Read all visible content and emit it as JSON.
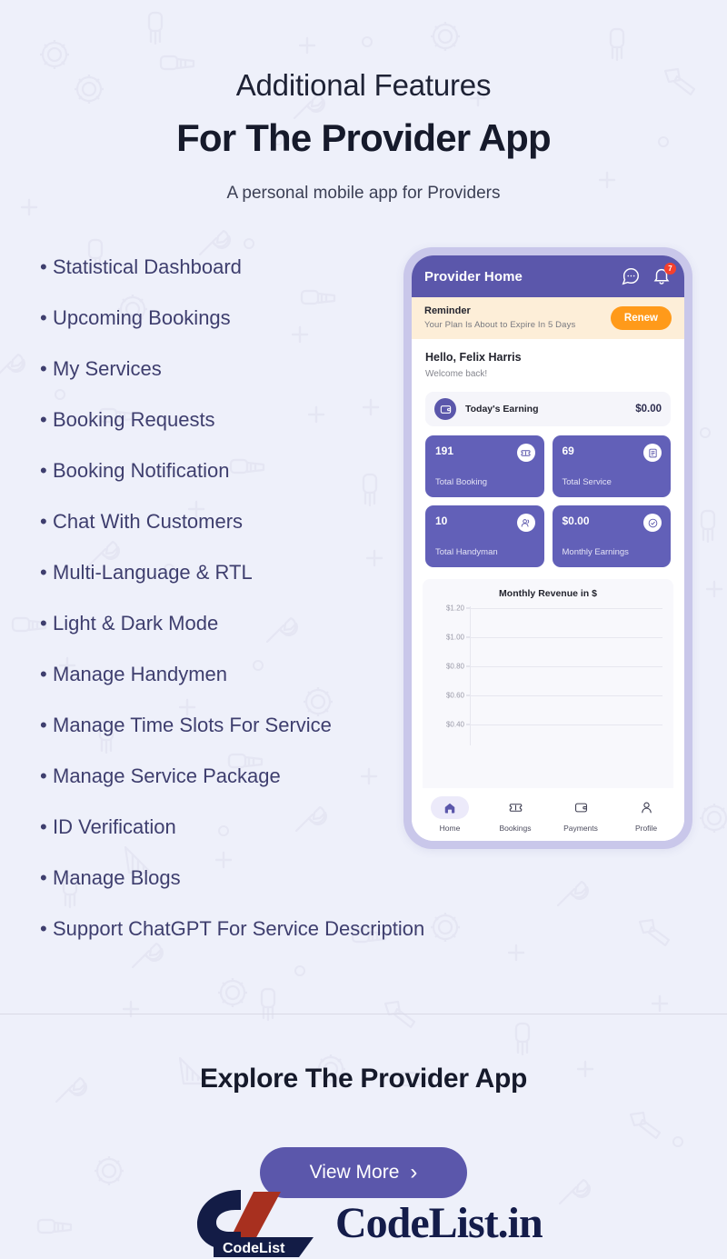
{
  "page": {
    "bg_color": "#eef0fa",
    "accent_purple": "#5b57ab",
    "tile_purple": "#6260b8",
    "accent_orange": "#ff9a1a",
    "badge_red": "#f6402c",
    "heading_color": "#161a2b",
    "list_text_color": "#3e3e6e"
  },
  "header": {
    "title_line1": "Additional Features",
    "title_line2": "For The Provider App",
    "subtitle": "A personal mobile app for Providers"
  },
  "features": [
    "Statistical Dashboard",
    "Upcoming Bookings",
    "My Services",
    "Booking Requests",
    "Booking Notification",
    "Chat With Customers",
    "Multi-Language & RTL",
    "Light & Dark Mode",
    "Manage Handymen",
    "Manage Time Slots For Service",
    "Manage Service Package",
    "ID Verification",
    "Manage Blogs",
    "Support ChatGPT For Service Description"
  ],
  "bullet_char": "•",
  "phone": {
    "app_bar": {
      "title": "Provider Home",
      "chat_icon": "chat-bubble-icon",
      "bell_icon": "bell-icon",
      "notification_count": "7"
    },
    "reminder": {
      "title": "Reminder",
      "message": "Your Plan Is About to Expire In 5 Days",
      "button_label": "Renew"
    },
    "greeting": {
      "main": "Hello, Felix Harris",
      "sub": "Welcome back!"
    },
    "earning": {
      "icon": "wallet-icon",
      "label": "Today's Earning",
      "value": "$0.00"
    },
    "stats": [
      {
        "value": "191",
        "label": "Total Booking",
        "icon": "ticket-icon"
      },
      {
        "value": "69",
        "label": "Total Service",
        "icon": "document-icon"
      },
      {
        "value": "10",
        "label": "Total Handyman",
        "icon": "people-icon"
      },
      {
        "value": "$0.00",
        "label": "Monthly Earnings",
        "icon": "badge-check-icon"
      }
    ],
    "nav": [
      {
        "label": "Home",
        "icon": "home-icon",
        "active": true
      },
      {
        "label": "Bookings",
        "icon": "ticket-icon",
        "active": false
      },
      {
        "label": "Payments",
        "icon": "wallet-icon",
        "active": false
      },
      {
        "label": "Profile",
        "icon": "person-icon",
        "active": false
      }
    ]
  },
  "chart_data": {
    "type": "line",
    "title": "Monthly Revenue in $",
    "xlabel": "",
    "ylabel": "",
    "categories": [],
    "values": [],
    "ytick_labels": [
      "$1.20",
      "$1.00",
      "$0.80",
      "$0.60",
      "$0.40"
    ],
    "ylim": [
      0.4,
      1.2
    ],
    "grid": true,
    "legend": "none",
    "note": "empty plot area - no data series rendered"
  },
  "footer": {
    "explore_title": "Explore The Provider App",
    "view_more_label": "View More",
    "view_more_chevron": "›",
    "logo_badge_text": "CodeList",
    "logo_wordmark": "CodeList.in"
  }
}
